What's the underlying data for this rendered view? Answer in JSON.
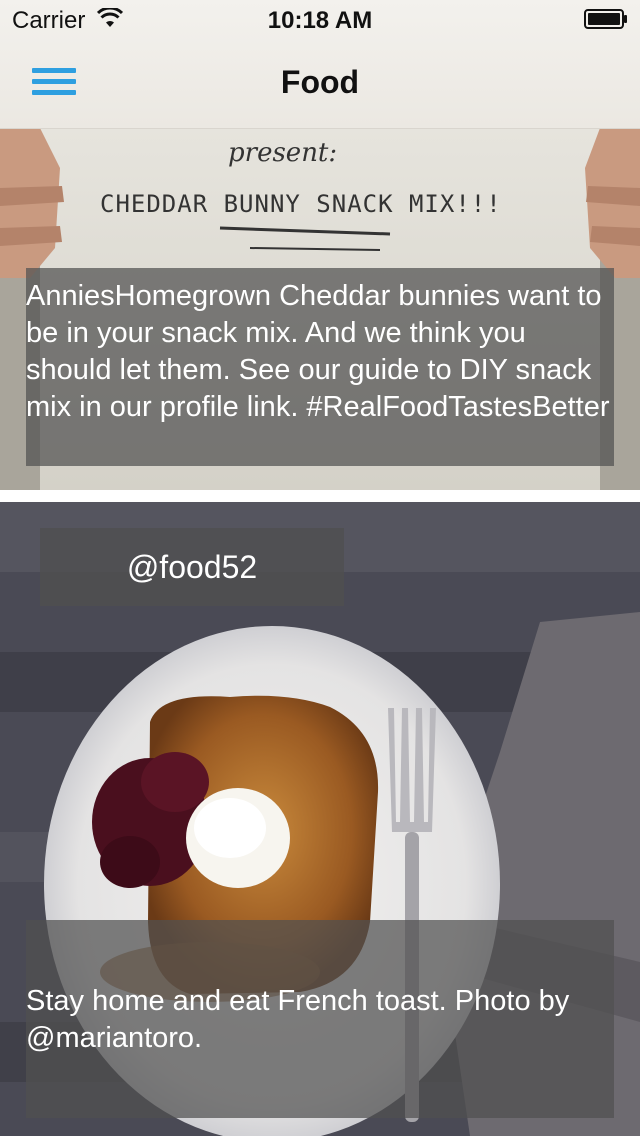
{
  "status_bar": {
    "carrier": "Carrier",
    "time": "10:18 AM",
    "wifi_icon": "wifi-icon",
    "battery_icon": "battery-icon"
  },
  "nav": {
    "title": "Food",
    "menu_icon": "hamburger-menu-icon",
    "accent_color": "#2e9fe0"
  },
  "feed": [
    {
      "username": "",
      "caption": "AnniesHomegrown Cheddar bunnies want to be in your snack mix. And we think you should let them. See our guide to DIY snack mix in our profile link. #RealFoodTastesBetter",
      "photo_lettering": [
        "present:",
        "CHEDDAR BUNNY SNACK MIX!!!"
      ]
    },
    {
      "username": "@food52",
      "caption": "Stay home and eat French toast. Photo by @mariantoro."
    }
  ]
}
